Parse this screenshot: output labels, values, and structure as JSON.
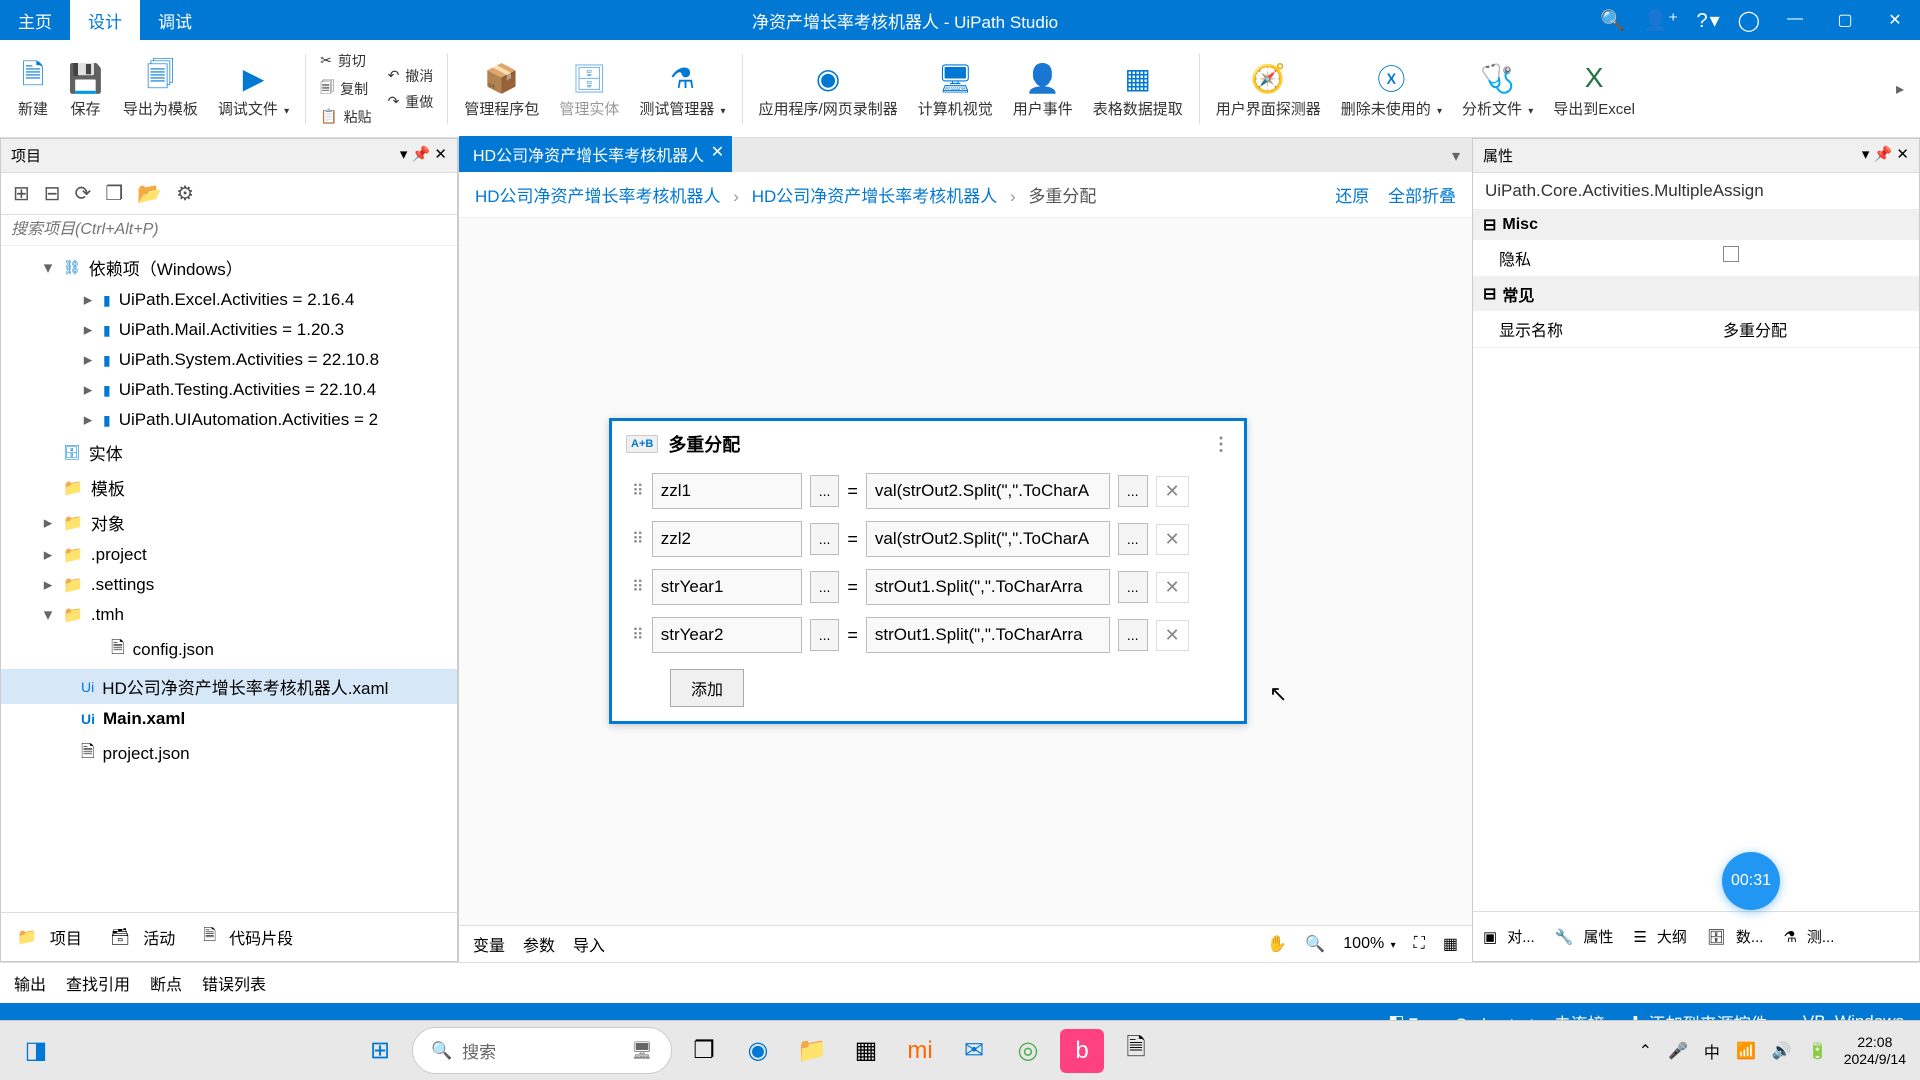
{
  "title": "净资产增长率考核机器人 - UiPath Studio",
  "menu": {
    "home": "主页",
    "design": "设计",
    "debug": "调试"
  },
  "ribbon": {
    "new": "新建",
    "save": "保存",
    "export_tpl": "导出为模板",
    "debug_file": "调试文件",
    "cut": "剪切",
    "copy": "复制",
    "paste": "粘贴",
    "undo": "撤消",
    "redo": "重做",
    "manage_pkg": "管理程序包",
    "manage_entity": "管理实体",
    "test_mgr": "测试管理器",
    "recorder": "应用程序/网页录制器",
    "cv": "计算机视觉",
    "user_events": "用户事件",
    "table_extract": "表格数据提取",
    "ui_explorer": "用户界面探测器",
    "remove_unused": "删除未使用的",
    "analyze": "分析文件",
    "export_excel": "导出到Excel"
  },
  "doc_tab": "HD公司净资产增长率考核机器人",
  "panel_project": {
    "title": "项目",
    "search_placeholder": "搜索项目(Ctrl+Alt+P)",
    "root": "依赖项（Windows）",
    "deps": [
      "UiPath.Excel.Activities = 2.16.4",
      "UiPath.Mail.Activities = 1.20.3",
      "UiPath.System.Activities = 22.10.8",
      "UiPath.Testing.Activities = 22.10.4",
      "UiPath.UIAutomation.Activities = 2"
    ],
    "folders": {
      "entities": "实体",
      "templates": "模板",
      "objects": "对象",
      "project": ".project",
      "settings": ".settings",
      "tmh": ".tmh"
    },
    "files": {
      "config": "config.json",
      "robot": "HD公司净资产增长率考核机器人.xaml",
      "main": "Main.xaml",
      "proj": "project.json"
    }
  },
  "breadcrumb": {
    "a": "HD公司净资产增长率考核机器人",
    "b": "HD公司净资产增长率考核机器人",
    "c": "多重分配",
    "restore": "还原",
    "collapse": "全部折叠"
  },
  "activity": {
    "title": "多重分配",
    "badge": "A+B",
    "rows": [
      {
        "var": "zzl1",
        "expr": "val(strOut2.Split(\",\".ToCharA"
      },
      {
        "var": "zzl2",
        "expr": "val(strOut2.Split(\",\".ToCharA"
      },
      {
        "var": "strYear1",
        "expr": "strOut1.Split(\",\".ToCharArra"
      },
      {
        "var": "strYear2",
        "expr": "strOut1.Split(\",\".ToCharArra"
      }
    ],
    "add": "添加"
  },
  "properties": {
    "title": "属性",
    "class": "UiPath.Core.Activities.MultipleAssign",
    "cat_misc": "Misc",
    "privacy": "隐私",
    "cat_common": "常见",
    "display_name": "显示名称",
    "display_val": "多重分配"
  },
  "bottom_tabs_left": {
    "project": "项目",
    "activity": "活动",
    "snippet": "代码片段"
  },
  "designer_footer": {
    "vars": "变量",
    "args": "参数",
    "imports": "导入",
    "zoom": "100%"
  },
  "bottom_bar": {
    "output": "输出",
    "find_ref": "查找引用",
    "breakpoints": "断点",
    "errors": "错误列表"
  },
  "right_tabs": {
    "obj": "对...",
    "props": "属性",
    "outline": "大纲",
    "data": "数...",
    "test": "测..."
  },
  "status": {
    "orch": "Orchestrator 未连接",
    "add_src": "添加到来源控件",
    "lang": "VB, Windows"
  },
  "taskbar": {
    "search": "搜索",
    "time": "22:08",
    "date": "2024/9/14"
  },
  "timer": "00:31"
}
